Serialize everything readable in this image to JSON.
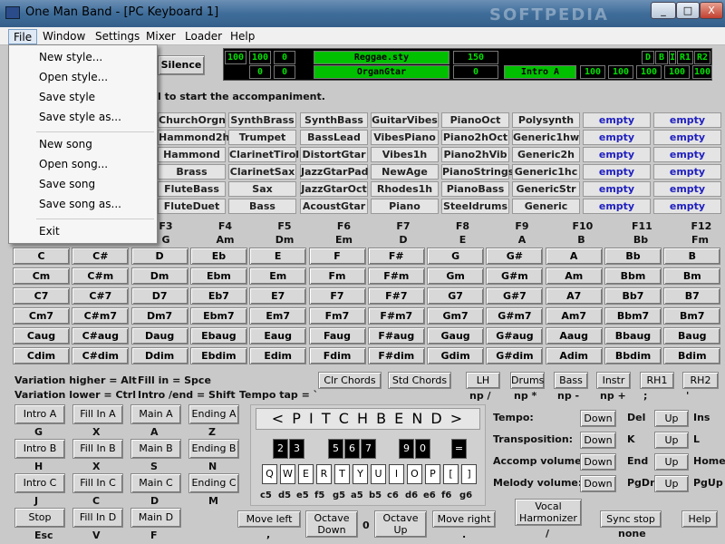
{
  "title": "One Man Band - [PC Keyboard 1]",
  "window_buttons": {
    "min": "_",
    "max": "□",
    "close": "X"
  },
  "menu": [
    "File",
    "Window",
    "Settings",
    "Mixer",
    "Loader",
    "Help"
  ],
  "file_menu": [
    "New style...",
    "Open style...",
    "Save style",
    "Save style as...",
    "New song",
    "Open song...",
    "Save song",
    "Save song as...",
    "Exit"
  ],
  "silence": "Silence",
  "display": {
    "row1": [
      "100",
      "100",
      "0",
      "Reggae.sty",
      "150",
      "D",
      "B",
      "I",
      "R1",
      "R2"
    ],
    "row2": [
      "0",
      "0",
      "OrganGtar",
      "0",
      "Intro A",
      "100",
      "100",
      "100",
      "100",
      "100"
    ]
  },
  "instruction": "l to start the accompaniment.",
  "patches": [
    [
      "ChurchOrgn",
      "SynthBrass",
      "SynthBass",
      "GuitarVibes",
      "PianoOct",
      "Polysynth",
      "empty",
      "empty"
    ],
    [
      "Hammond2h",
      "Trumpet",
      "BassLead",
      "VibesPiano",
      "Piano2hOct",
      "Generic1hw",
      "empty",
      "empty"
    ],
    [
      "Hammond",
      "ClarinetTirol",
      "DistortGtar",
      "Vibes1h",
      "Piano2hVib",
      "Generic2h",
      "empty",
      "empty"
    ],
    [
      "Brass",
      "ClarinetSax",
      "JazzGtarPad",
      "NewAge",
      "PianoStrings",
      "Generic1hc",
      "empty",
      "empty"
    ],
    [
      "FluteBass",
      "Sax",
      "JazzGtarOct",
      "Rhodes1h",
      "PianoBass",
      "GenericStr",
      "empty",
      "empty"
    ],
    [
      "FluteDuet",
      "Bass",
      "AcoustGtar",
      "Piano",
      "Steeldrums",
      "Generic",
      "empty",
      "empty"
    ]
  ],
  "fkeys": [
    "F3",
    "F4",
    "F5",
    "F6",
    "F7",
    "F8",
    "F9",
    "F10",
    "F11",
    "F12"
  ],
  "fnotes": [
    "G",
    "Am",
    "Dm",
    "Em",
    "D",
    "E",
    "A",
    "B",
    "Bb",
    "Fm"
  ],
  "chords": [
    [
      "C",
      "C#",
      "D",
      "Eb",
      "E",
      "F",
      "F#",
      "G",
      "G#",
      "A",
      "Bb",
      "B"
    ],
    [
      "Cm",
      "C#m",
      "Dm",
      "Ebm",
      "Em",
      "Fm",
      "F#m",
      "Gm",
      "G#m",
      "Am",
      "Bbm",
      "Bm"
    ],
    [
      "C7",
      "C#7",
      "D7",
      "Eb7",
      "E7",
      "F7",
      "F#7",
      "G7",
      "G#7",
      "A7",
      "Bb7",
      "B7"
    ],
    [
      "Cm7",
      "C#m7",
      "Dm7",
      "Ebm7",
      "Em7",
      "Fm7",
      "F#m7",
      "Gm7",
      "G#m7",
      "Am7",
      "Bbm7",
      "Bm7"
    ],
    [
      "Caug",
      "C#aug",
      "Daug",
      "Ebaug",
      "Eaug",
      "Faug",
      "F#aug",
      "Gaug",
      "G#aug",
      "Aaug",
      "Bbaug",
      "Baug"
    ],
    [
      "Cdim",
      "C#dim",
      "Ddim",
      "Ebdim",
      "Edim",
      "Fdim",
      "F#dim",
      "Gdim",
      "G#dim",
      "Adim",
      "Bbdim",
      "Bdim"
    ]
  ],
  "info": {
    "var_hi": "Variation higher = Alt",
    "var_lo": "Variation lower = Ctrl",
    "fill": "Fill in = Spce",
    "intro_end": "Intro /end = Shift",
    "tempo_tap": "Tempo tap = `"
  },
  "clr": "Clr Chords",
  "std": "Std Chords",
  "parts": [
    "LH",
    "Drums",
    "Bass",
    "Instr",
    "RH1",
    "RH2"
  ],
  "part_keys": [
    "np /",
    "np *",
    "np -",
    "np +",
    ";",
    "'"
  ],
  "sections": [
    [
      {
        "l": "Intro A",
        "k": "G"
      },
      {
        "l": "Fill In A",
        "k": "X"
      },
      {
        "l": "Main A",
        "k": "A"
      },
      {
        "l": "Ending A",
        "k": "Z"
      }
    ],
    [
      {
        "l": "Intro B",
        "k": "H"
      },
      {
        "l": "Fill In B",
        "k": "X"
      },
      {
        "l": "Main B",
        "k": "S"
      },
      {
        "l": "Ending B",
        "k": "N"
      }
    ],
    [
      {
        "l": "Intro C",
        "k": "J"
      },
      {
        "l": "Fill In C",
        "k": "C"
      },
      {
        "l": "Main C",
        "k": "D"
      },
      {
        "l": "Ending C",
        "k": "M"
      }
    ],
    [
      {
        "l": "Stop",
        "k": "Esc"
      },
      {
        "l": "Fill In D",
        "k": "V"
      },
      {
        "l": "Main D",
        "k": "F"
      }
    ]
  ],
  "pitchbend": "< P I T C H B E N D >",
  "black_keys": [
    "2",
    "3",
    "5",
    "6",
    "7",
    "9",
    "0",
    "="
  ],
  "white_keys": [
    "Q",
    "W",
    "E",
    "R",
    "T",
    "Y",
    "U",
    "I",
    "O",
    "P",
    "[",
    "]"
  ],
  "notes": [
    "c5",
    "d5",
    "e5",
    "f5",
    "g5",
    "a5",
    "b5",
    "c6",
    "d6",
    "e6",
    "f6",
    "g6"
  ],
  "controls": [
    {
      "l": "Tempo:",
      "k1": "Del",
      "k2": "Ins"
    },
    {
      "l": "Transposition:",
      "k1": "K",
      "k2": "L"
    },
    {
      "l": "Accomp volume:",
      "k1": "End",
      "k2": "Home"
    },
    {
      "l": "Melody volume:",
      "k1": "PgDn",
      "k2": "PgUp"
    }
  ],
  "down": "Down",
  "up": "Up",
  "bottom": {
    "move_left": "Move left",
    "move_left_k": ",",
    "oct_down": "Octave Down",
    "oct_val": "0",
    "oct_up": "Octave Up",
    "move_right": "Move right",
    "move_right_k": ".",
    "vocal": "Vocal Harmonizer",
    "vocal_k": "/",
    "sync": "Sync stop",
    "sync_k": "none",
    "help": "Help"
  },
  "watermark": "SOFTPEDIA"
}
